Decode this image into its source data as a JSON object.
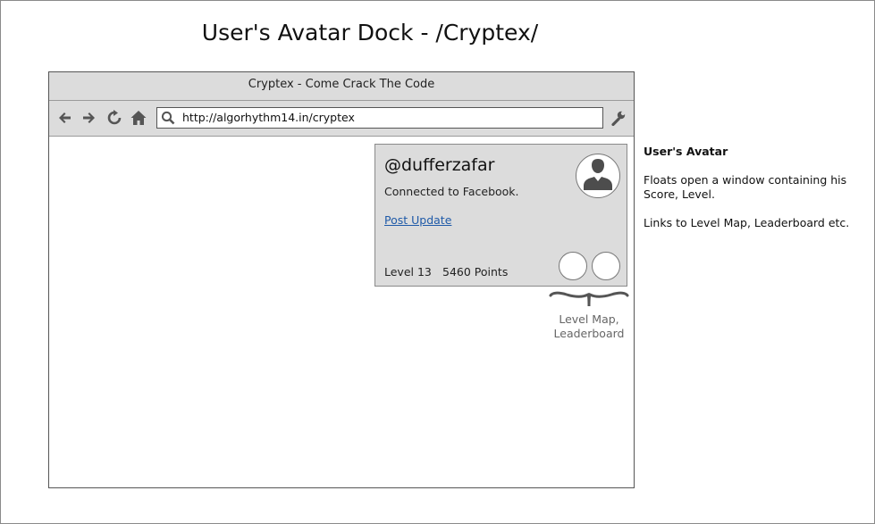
{
  "page": {
    "title": "User's Avatar Dock - /Cryptex/"
  },
  "browser": {
    "window_title": "Cryptex - Come Crack The Code",
    "url": "http://algorhythm14.in/cryptex",
    "toolbar_icons": [
      "back-icon",
      "forward-icon",
      "reload-icon",
      "home-icon",
      "search-icon",
      "wrench-icon"
    ]
  },
  "avatar_panel": {
    "handle": "@dufferzafar",
    "status": "Connected to Facebook.",
    "link_label": "Post Update",
    "level": "Level 13",
    "points": "5460 Points",
    "avatar_icon": "user-silhouette-icon",
    "link_color": "#1f5aa8",
    "panel_color": "#dcdcdc"
  },
  "annotation": {
    "brace_label_line1": "Level Map,",
    "brace_label_line2": "Leaderboard"
  },
  "notes": {
    "title": "User's Avatar",
    "line1": "Floats open a window containing his Score, Level.",
    "line2": "Links to Level Map, Leaderboard etc."
  }
}
